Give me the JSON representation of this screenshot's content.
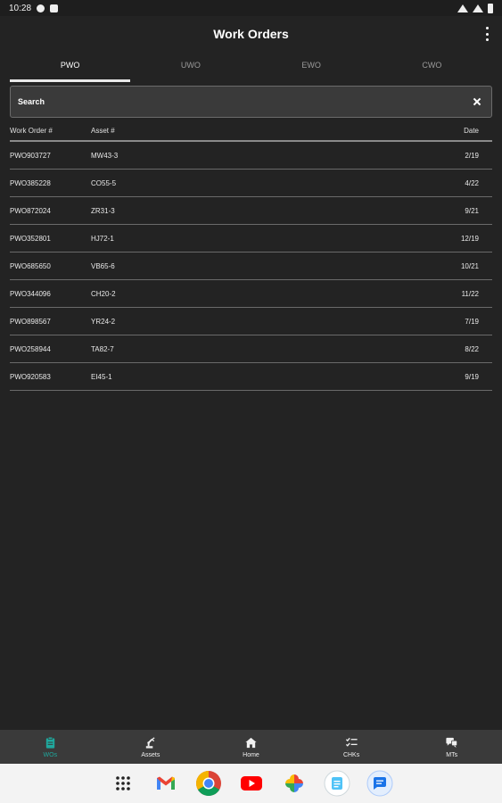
{
  "status_bar": {
    "time": "10:28"
  },
  "app_bar": {
    "title": "Work Orders"
  },
  "tabs": [
    {
      "label": "PWO",
      "active": true
    },
    {
      "label": "UWO",
      "active": false
    },
    {
      "label": "EWO",
      "active": false
    },
    {
      "label": "CWO",
      "active": false
    }
  ],
  "search": {
    "placeholder": "Search",
    "value": ""
  },
  "table": {
    "headers": {
      "work_order": "Work Order #",
      "asset": "Asset #",
      "date": "Date"
    },
    "rows": [
      {
        "work_order": "PWO903727",
        "asset": "MW43-3",
        "date": "2/19"
      },
      {
        "work_order": "PWO385228",
        "asset": "CO55-5",
        "date": "4/22"
      },
      {
        "work_order": "PWO872024",
        "asset": "ZR31-3",
        "date": "9/21"
      },
      {
        "work_order": "PWO352801",
        "asset": "HJ72-1",
        "date": "12/19"
      },
      {
        "work_order": "PWO685650",
        "asset": "VB65-6",
        "date": "10/21"
      },
      {
        "work_order": "PWO344096",
        "asset": "CH20-2",
        "date": "11/22"
      },
      {
        "work_order": "PWO898567",
        "asset": "YR24-2",
        "date": "7/19"
      },
      {
        "work_order": "PWO258944",
        "asset": "TA82-7",
        "date": "8/22"
      },
      {
        "work_order": "PWO920583",
        "asset": "EI45-1",
        "date": "9/19"
      }
    ]
  },
  "bottom_nav": {
    "items": [
      {
        "label": "WOs",
        "icon": "clipboard-icon",
        "active": true
      },
      {
        "label": "Assets",
        "icon": "robot-arm-icon",
        "active": false
      },
      {
        "label": "Home",
        "icon": "home-icon",
        "active": false
      },
      {
        "label": "CHKs",
        "icon": "checklist-icon",
        "active": false
      },
      {
        "label": "MTs",
        "icon": "message-icon",
        "active": false
      }
    ]
  },
  "dock": {
    "apps": [
      "app-grid-icon",
      "gmail-icon",
      "chrome-icon",
      "youtube-icon",
      "photos-icon",
      "files-icon",
      "messages-icon"
    ]
  },
  "colors": {
    "accent": "#1fa89d",
    "background": "#232323",
    "nav_background": "#3a3a3a"
  }
}
